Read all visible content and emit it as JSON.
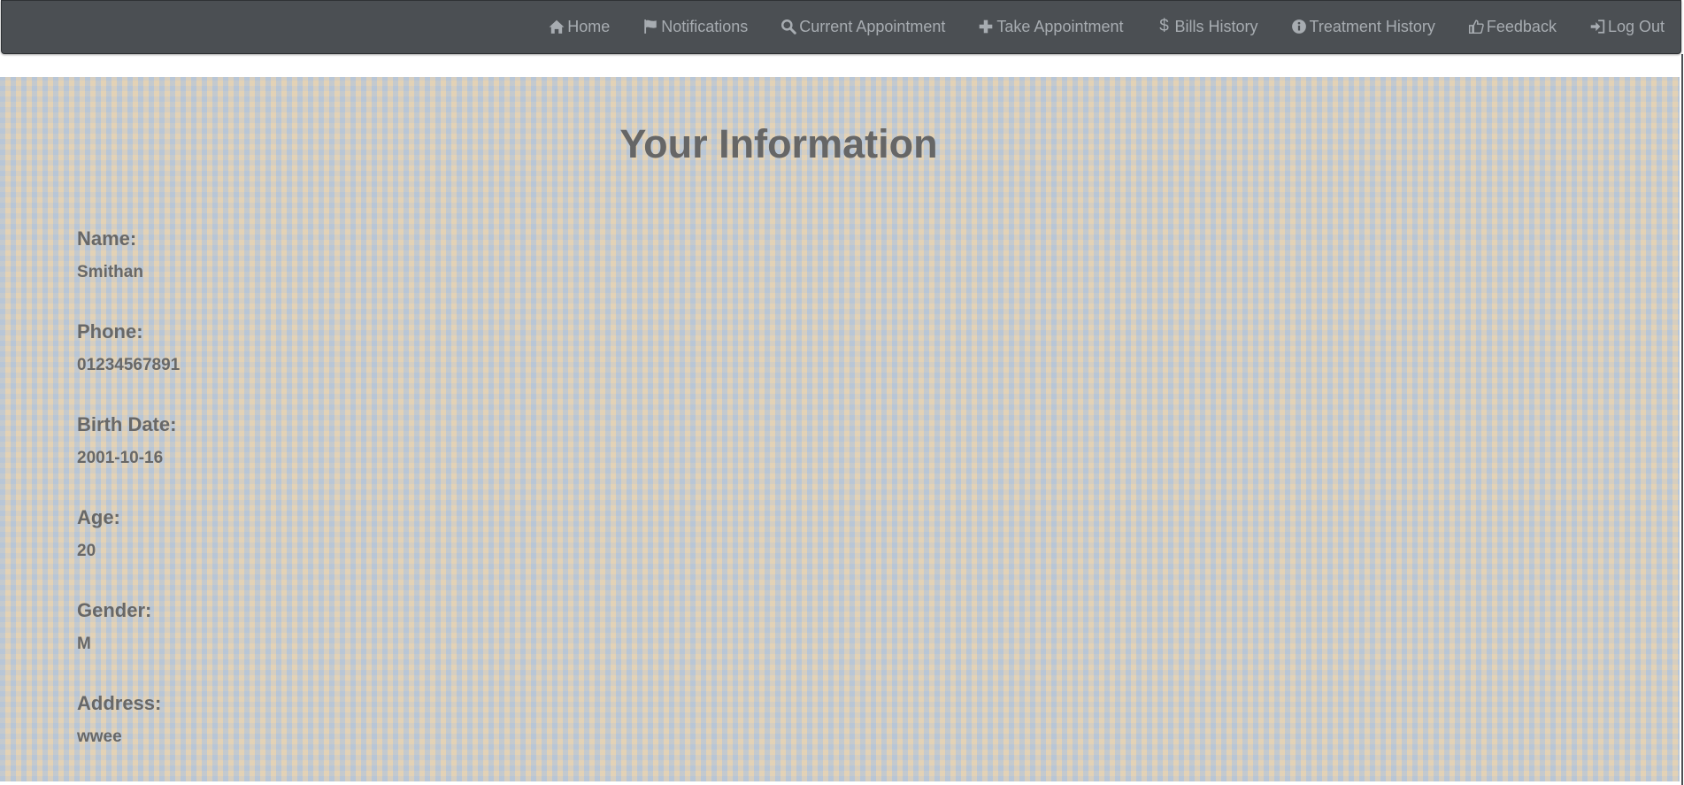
{
  "nav": {
    "items": [
      {
        "label": "Home",
        "icon": "home-icon"
      },
      {
        "label": "Notifications",
        "icon": "flag-icon"
      },
      {
        "label": "Current Appointment",
        "icon": "search-icon"
      },
      {
        "label": "Take Appointment",
        "icon": "plus-icon"
      },
      {
        "label": "Bills History",
        "icon": "dollar-icon"
      },
      {
        "label": "Treatment History",
        "icon": "info-icon"
      },
      {
        "label": "Feedback",
        "icon": "thumbs-up-icon"
      },
      {
        "label": "Log Out",
        "icon": "log-out-icon"
      }
    ]
  },
  "page": {
    "title": "Your Information"
  },
  "info": {
    "name": {
      "label": "Name:",
      "value": "Smithan"
    },
    "phone": {
      "label": "Phone:",
      "value": "01234567891"
    },
    "birth_date": {
      "label": "Birth Date:",
      "value": "2001-10-16"
    },
    "age": {
      "label": "Age:",
      "value": "20"
    },
    "gender": {
      "label": "Gender:",
      "value": "M"
    },
    "address": {
      "label": "Address:",
      "value": "wwee"
    }
  },
  "colors": {
    "navbar_bg": "#4b4f53",
    "nav_text": "#a7acb1",
    "text": "#666666"
  }
}
